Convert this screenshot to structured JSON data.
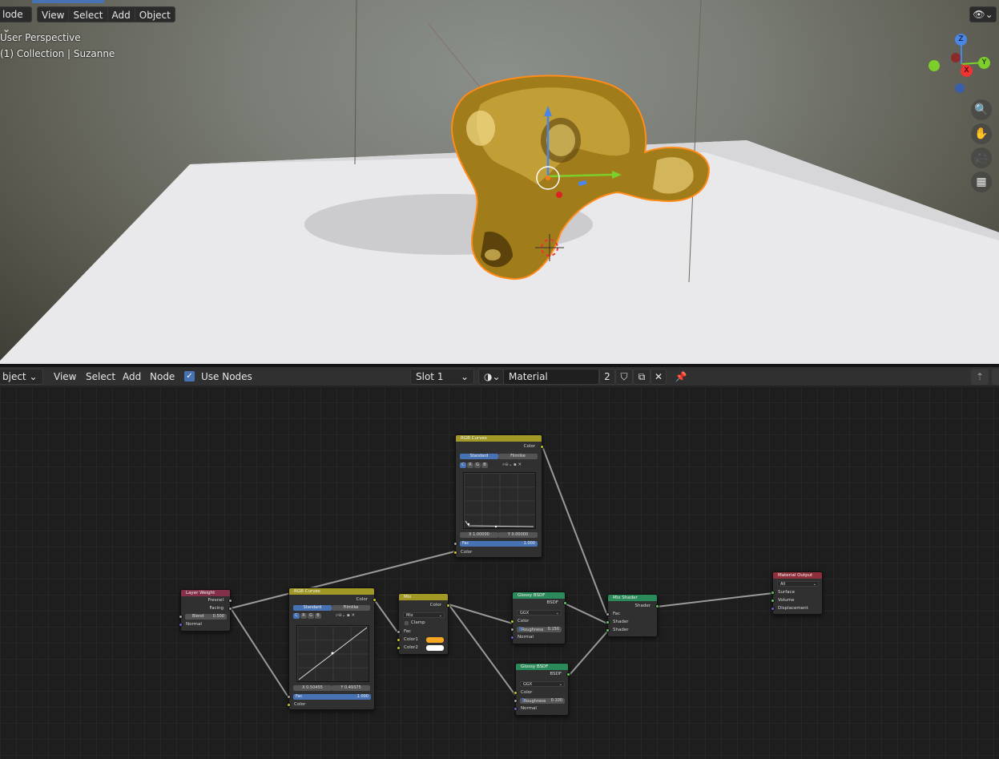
{
  "viewport": {
    "mode_label": "Object Mode",
    "mode_visible": "lode",
    "menu": [
      "View",
      "Select",
      "Add",
      "Object"
    ],
    "overlay_title": "User Perspective",
    "overlay_collection": "(1) Collection | Suzanne",
    "gizmo": {
      "z": "Z",
      "y": "Y",
      "x": "X"
    },
    "colors": {
      "gold": "#c9a227",
      "selection_outline": "#ff8c1a",
      "plane": "#e8e8ea"
    }
  },
  "node_editor": {
    "header": {
      "type_visible": "bject",
      "menu": [
        "View",
        "Select",
        "Add",
        "Node"
      ],
      "use_nodes_label": "Use Nodes",
      "use_nodes_checked": true,
      "slot": "Slot 1",
      "material_name": "Material",
      "user_count": "2"
    },
    "nodes": {
      "layer_weight": {
        "title": "Layer Weight",
        "out_fresnel": "Fresnel",
        "out_facing": "Facing",
        "blend_label": "Blend",
        "blend_value": "0.500",
        "in_normal": "Normal"
      },
      "rgb_curves_1": {
        "title": "RGB Curves",
        "out": "Color",
        "tab_standard": "Standard",
        "tab_filmlike": "Filmlike",
        "channels": [
          "C",
          "R",
          "G",
          "B"
        ],
        "x": "X 0.50455",
        "y": "Y 0.49375",
        "fac_label": "Fac",
        "fac_value": "1.000",
        "in_color": "Color"
      },
      "rgb_curves_2": {
        "title": "RGB Curves",
        "out": "Color",
        "tab_standard": "Standard",
        "tab_filmlike": "Filmlike",
        "channels": [
          "C",
          "R",
          "G",
          "B"
        ],
        "x": "X 1.00000",
        "y": "Y 0.00000",
        "fac_label": "Fac",
        "fac_value": "1.000",
        "in_color": "Color"
      },
      "mix": {
        "title": "Mix",
        "out": "Color",
        "blend_type": "Mix",
        "clamp": "Clamp",
        "in_fac": "Fac",
        "in_color1": "Color1",
        "in_color2": "Color2",
        "color1": "#f5a623",
        "color2": "#ffffff"
      },
      "glossy_1": {
        "title": "Glossy BSDF",
        "out": "BSDF",
        "distribution": "GGX",
        "in_color": "Color",
        "roughness_label": "Roughness",
        "roughness_value": "0.150",
        "in_normal": "Normal"
      },
      "glossy_2": {
        "title": "Glossy BSDF",
        "out": "BSDF",
        "distribution": "GGX",
        "in_color": "Color",
        "roughness_label": "Roughness",
        "roughness_value": "0.100",
        "in_normal": "Normal"
      },
      "mix_shader": {
        "title": "Mix Shader",
        "out": "Shader",
        "in_fac": "Fac",
        "in_shader1": "Shader",
        "in_shader2": "Shader"
      },
      "material_output": {
        "title": "Material Output",
        "target": "All",
        "in_surface": "Surface",
        "in_volume": "Volume",
        "in_displacement": "Displacement"
      }
    },
    "header_colors": {
      "input": "#83314a",
      "color": "#a19826",
      "shader": "#2a8a5a",
      "output": "#8f2f3c"
    }
  }
}
